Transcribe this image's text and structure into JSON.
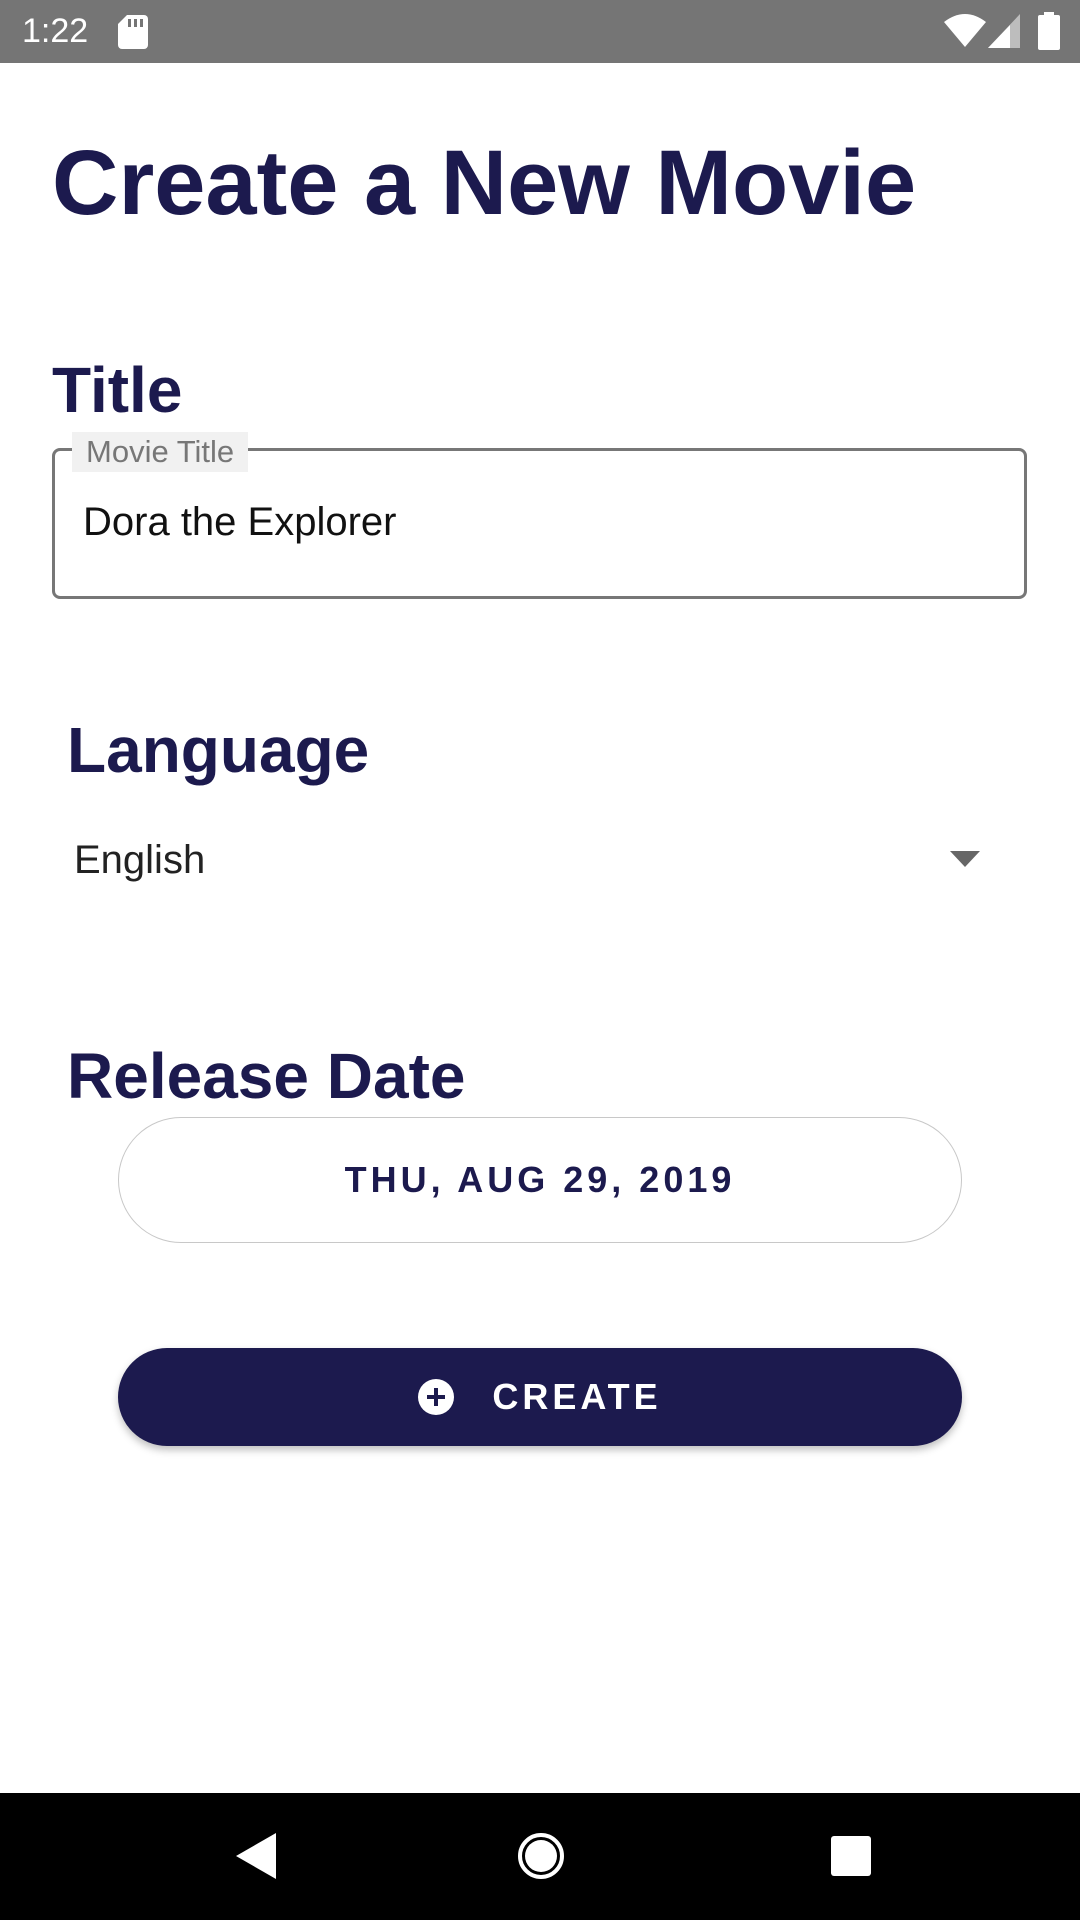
{
  "status_bar": {
    "time": "1:22",
    "icons": [
      "sd-card-icon",
      "wifi-icon",
      "cell-signal-icon",
      "battery-icon"
    ],
    "background": "#757575"
  },
  "page": {
    "title": "Create a New Movie"
  },
  "title_section": {
    "label": "Title",
    "field_label": "Movie Title",
    "field_value": "Dora the Explorer"
  },
  "language_section": {
    "label": "Language",
    "selected": "English",
    "icon": "chevron-down-icon"
  },
  "release_section": {
    "label": "Release Date",
    "date_value": "THU, AUG 29, 2019"
  },
  "create_button": {
    "label": "CREATE",
    "icon": "add-circle-icon"
  },
  "nav_bar": {
    "icons": [
      "back-icon",
      "home-icon",
      "recents-icon"
    ]
  },
  "colors": {
    "primary": "#1c1a4e",
    "surface": "#ffffff",
    "outline": "#777777"
  }
}
